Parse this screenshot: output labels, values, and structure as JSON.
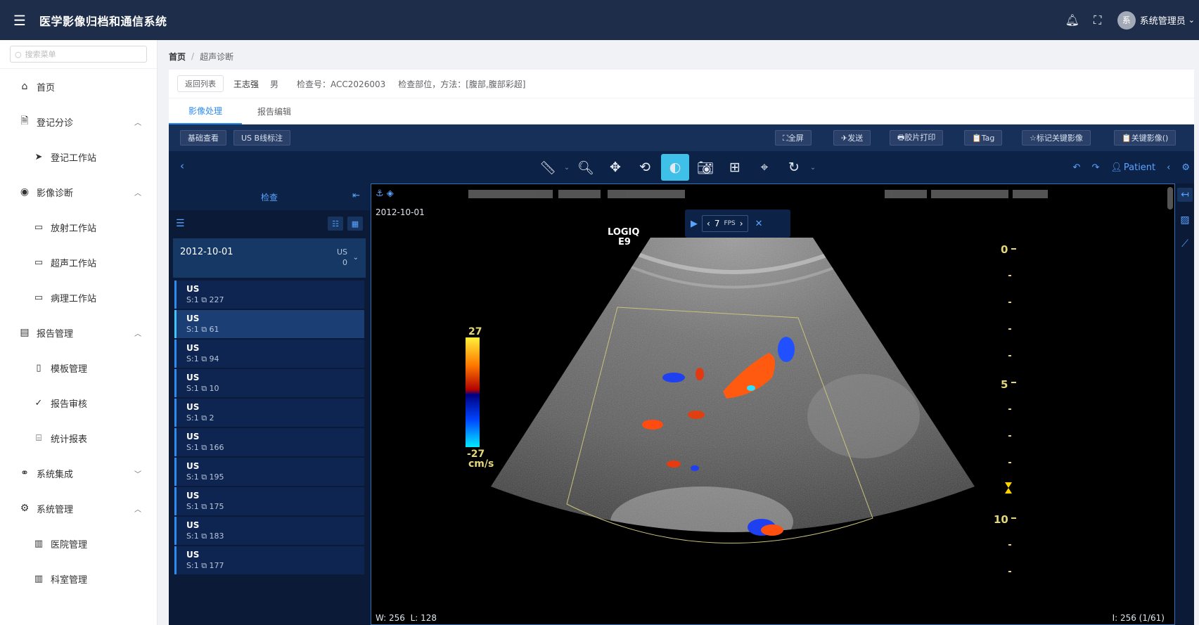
{
  "header": {
    "title": "医学影像归档和通信系统",
    "user": {
      "avatar_char": "系",
      "name": "系统管理员"
    }
  },
  "sidebar": {
    "search_placeholder": "搜索菜单",
    "items": [
      {
        "label": "首页",
        "icon": "home-icon"
      },
      {
        "label": "登记分诊",
        "icon": "document-icon",
        "expanded": true,
        "children": [
          {
            "label": "登记工作站",
            "icon": "send-icon"
          }
        ]
      },
      {
        "label": "影像诊断",
        "icon": "eye-icon",
        "expanded": true,
        "children": [
          {
            "label": "放射工作站",
            "icon": "monitor-icon"
          },
          {
            "label": "超声工作站",
            "icon": "monitor-icon"
          },
          {
            "label": "病理工作站",
            "icon": "monitor-icon"
          }
        ]
      },
      {
        "label": "报告管理",
        "icon": "inbox-icon",
        "expanded": true,
        "children": [
          {
            "label": "模板管理",
            "icon": "notebook-icon"
          },
          {
            "label": "报告审核",
            "icon": "check-icon"
          },
          {
            "label": "统计报表",
            "icon": "presentation-icon"
          }
        ]
      },
      {
        "label": "系统集成",
        "icon": "link-icon",
        "expanded": false
      },
      {
        "label": "系统管理",
        "icon": "gear-icon",
        "expanded": true,
        "children": [
          {
            "label": "医院管理",
            "icon": "building-icon"
          },
          {
            "label": "科室管理",
            "icon": "building-icon"
          }
        ]
      }
    ]
  },
  "breadcrumb": {
    "home": "首页",
    "current": "超声诊断"
  },
  "patient": {
    "back_label": "返回列表",
    "name": "王志强",
    "sex": "男",
    "accession": "检查号：ACC2026003",
    "body_part": "检查部位，方法：[腹部,腹部彩超]"
  },
  "tabs": [
    {
      "label": "影像处理",
      "active": true
    },
    {
      "label": "报告编辑",
      "active": false
    }
  ],
  "viewer": {
    "toolbar1": {
      "left": [
        "基础查看",
        "US B线标注"
      ],
      "right": [
        "⛶全屏",
        "✈发送",
        "🖶胶片打印",
        "📋Tag",
        "☆标记关键影像",
        "📋关键影像()"
      ]
    },
    "toolbar2": {
      "tools": [
        "ruler-icon",
        "zoom-icon",
        "pan-icon",
        "rotate-3d-icon",
        "contrast-icon",
        "camera-icon",
        "grid-icon",
        "crosshair-icon",
        "refresh-icon"
      ],
      "patient_label": "Patient"
    },
    "study_panel": {
      "header": "检查",
      "study": {
        "date": "2012-10-01",
        "modality": "US",
        "count": "0"
      },
      "series": [
        {
          "modality": "US",
          "series": "S:1",
          "count": "227"
        },
        {
          "modality": "US",
          "series": "S:1",
          "count": "61",
          "selected": true
        },
        {
          "modality": "US",
          "series": "S:1",
          "count": "94"
        },
        {
          "modality": "US",
          "series": "S:1",
          "count": "10"
        },
        {
          "modality": "US",
          "series": "S:1",
          "count": "2"
        },
        {
          "modality": "US",
          "series": "S:1",
          "count": "166"
        },
        {
          "modality": "US",
          "series": "S:1",
          "count": "195"
        },
        {
          "modality": "US",
          "series": "S:1",
          "count": "175"
        },
        {
          "modality": "US",
          "series": "S:1",
          "count": "183"
        },
        {
          "modality": "US",
          "series": "S:1",
          "count": "177"
        }
      ]
    },
    "image": {
      "date": "2012-10-01",
      "device_line1": "LOGIQ",
      "device_line2": "E9",
      "fps_value": "7",
      "fps_label": "FPS",
      "scale_top": "27",
      "scale_bottom": "-27",
      "scale_unit": "cm/s",
      "depth_labels": [
        "0",
        "5",
        "10"
      ],
      "window_width": "W: 256",
      "window_level": "L: 128",
      "frame_info": "I: 256 (1/61)"
    }
  }
}
